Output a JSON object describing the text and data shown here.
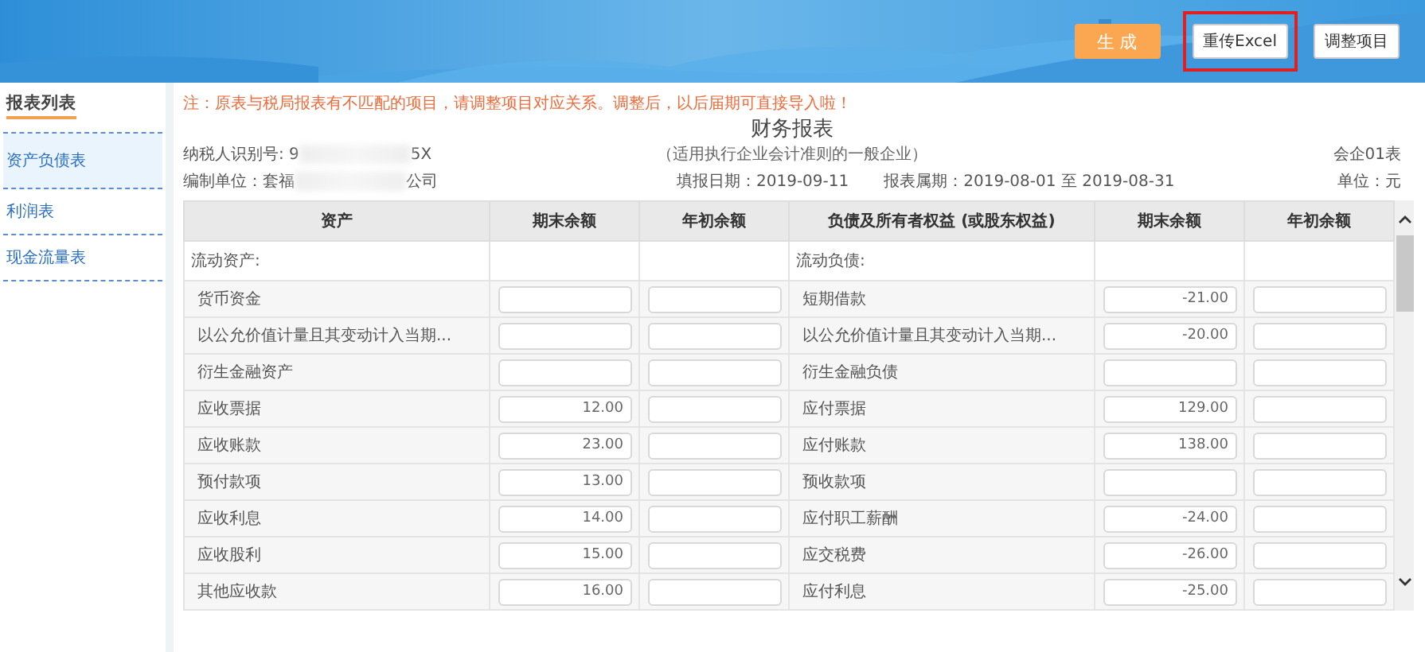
{
  "header": {
    "buttons": [
      {
        "label": "生 成",
        "kind": "primary",
        "highlighted": false
      },
      {
        "label": "重传Excel",
        "kind": "plain",
        "highlighted": true
      },
      {
        "label": "调整项目",
        "kind": "plain",
        "highlighted": false
      }
    ]
  },
  "sidebar": {
    "title": "报表列表",
    "items": [
      {
        "label": "资产负债表",
        "selected": true
      },
      {
        "label": "利润表",
        "selected": false
      },
      {
        "label": "现金流量表",
        "selected": false
      }
    ]
  },
  "report": {
    "notice": "注：原表与税局报表有不匹配的项目，请调整项目对应关系。调整后，以后届期可直接导入啦！",
    "taxpayer_label": "纳税人识别号: 9",
    "taxpayer_tail": "5X",
    "title": "财务报表",
    "subtitle": "（适用执行企业会计准则的一般企业）",
    "form_code": "会企01表",
    "unit_label": "编制单位：套福",
    "unit_tail": "公司",
    "fill_date": "填报日期：2019-09-11",
    "period": "报表属期：2019-08-01 至 2019-08-31",
    "currency": "单位：元"
  },
  "table": {
    "columns": [
      "资产",
      "期末余额",
      "年初余额",
      "负债及所有者权益 (或股东权益)",
      "期末余额",
      "年初余额"
    ],
    "rows": [
      {
        "kind": "section",
        "left": {
          "name": "流动资产:"
        },
        "right": {
          "name": "流动负债:"
        }
      },
      {
        "kind": "item",
        "left": {
          "name": "货币资金"
        },
        "right": {
          "name": "短期借款",
          "end": "-21.00"
        }
      },
      {
        "kind": "item",
        "left": {
          "name": "以公允价值计量且其变动计入当期..."
        },
        "right": {
          "name": "以公允价值计量且其变动计入当期...",
          "end": "-20.00"
        }
      },
      {
        "kind": "item",
        "left": {
          "name": "衍生金融资产"
        },
        "right": {
          "name": "衍生金融负债"
        }
      },
      {
        "kind": "item",
        "left": {
          "name": "应收票据",
          "end": "12.00"
        },
        "right": {
          "name": "应付票据",
          "end": "129.00"
        }
      },
      {
        "kind": "item",
        "left": {
          "name": "应收账款",
          "end": "23.00"
        },
        "right": {
          "name": "应付账款",
          "end": "138.00"
        }
      },
      {
        "kind": "item",
        "left": {
          "name": "预付款项",
          "end": "13.00"
        },
        "right": {
          "name": "预收款项"
        }
      },
      {
        "kind": "item",
        "left": {
          "name": "应收利息",
          "end": "14.00"
        },
        "right": {
          "name": "应付职工薪酬",
          "end": "-24.00"
        }
      },
      {
        "kind": "item",
        "left": {
          "name": "应收股利",
          "end": "15.00"
        },
        "right": {
          "name": "应交税费",
          "end": "-26.00"
        }
      },
      {
        "kind": "item",
        "left": {
          "name": "其他应收款",
          "end": "16.00"
        },
        "right": {
          "name": "应付利息",
          "end": "-25.00"
        }
      }
    ]
  }
}
